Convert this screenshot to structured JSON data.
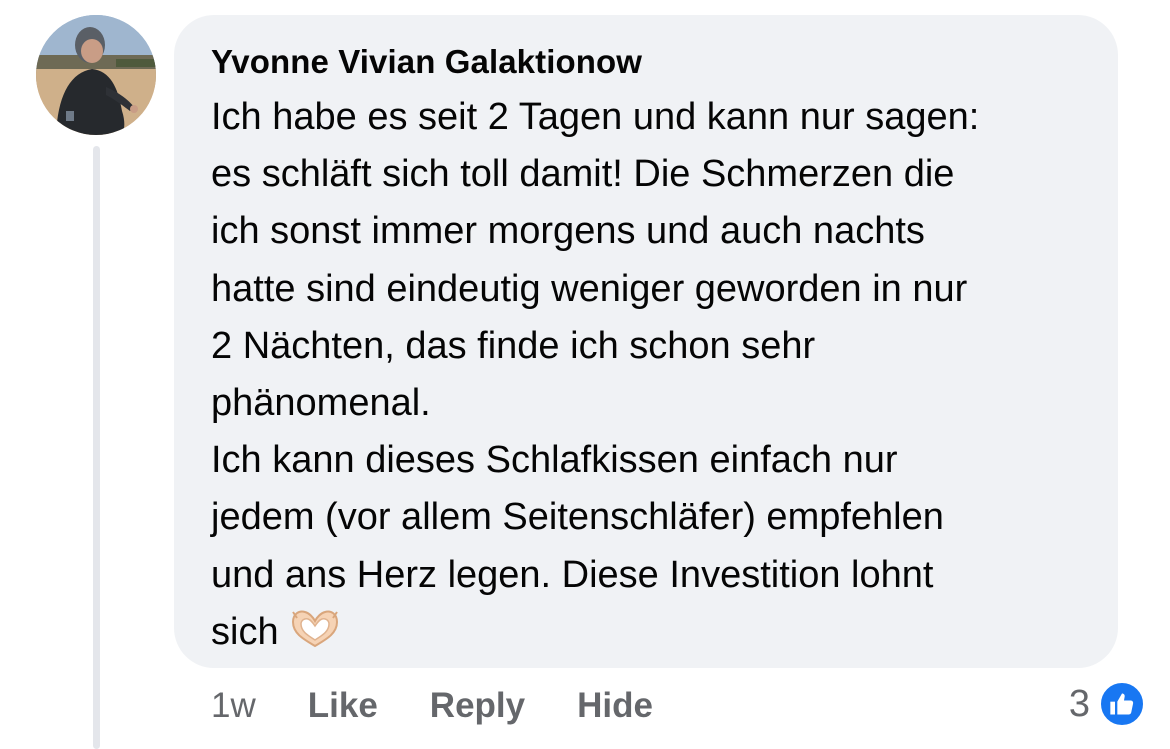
{
  "comment": {
    "author": "Yvonne Vivian Galaktionow",
    "text": "Ich habe es seit 2 Tagen und kann nur sagen:\nes schläft sich toll damit! Die Schmerzen die\nich sonst immer morgens und auch nachts\nhatte sind eindeutig weniger geworden in nur\n2 Nächten, das finde ich schon sehr\nphänomenal.\nIch kann dieses Schlafkissen einfach nur\njedem (vor allem Seitenschläfer) empfehlen\nund ans Herz legen. Diese Investition lohnt\nsich",
    "emoji": "heart-hands",
    "time": "1w",
    "actions": {
      "like": "Like",
      "reply": "Reply",
      "hide": "Hide"
    },
    "reaction_count": "3",
    "reaction_icon": "thumbs-up-icon"
  },
  "colors": {
    "bubble": "#f0f2f5",
    "text": "#050505",
    "meta": "#65676b",
    "like_blue": "#1877f2"
  }
}
